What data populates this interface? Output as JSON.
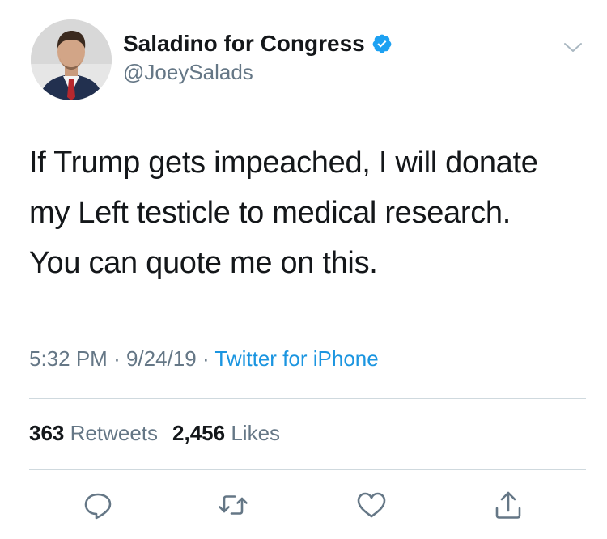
{
  "tweet": {
    "author": {
      "display_name": "Saladino for Congress",
      "handle": "@JoeySalads",
      "verified": true,
      "avatar_icon": "profile-photo"
    },
    "text_lines": [
      "If Trump gets impeached, I will donate",
      "my Left testicle to medical research.",
      "You can quote me on this."
    ],
    "time": "5:32 PM",
    "separator": "·",
    "date": "9/24/19",
    "source": "Twitter for iPhone",
    "stats": {
      "retweets_count": "363",
      "retweets_label": "Retweets",
      "likes_count": "2,456",
      "likes_label": "Likes"
    },
    "actions": [
      "reply-icon",
      "retweet-icon",
      "like-icon",
      "share-icon"
    ]
  },
  "colors": {
    "text": "#14171a",
    "secondary": "#657786",
    "link": "#1b95e0",
    "verified": "#1da1f2",
    "divider": "#cfd9de"
  }
}
